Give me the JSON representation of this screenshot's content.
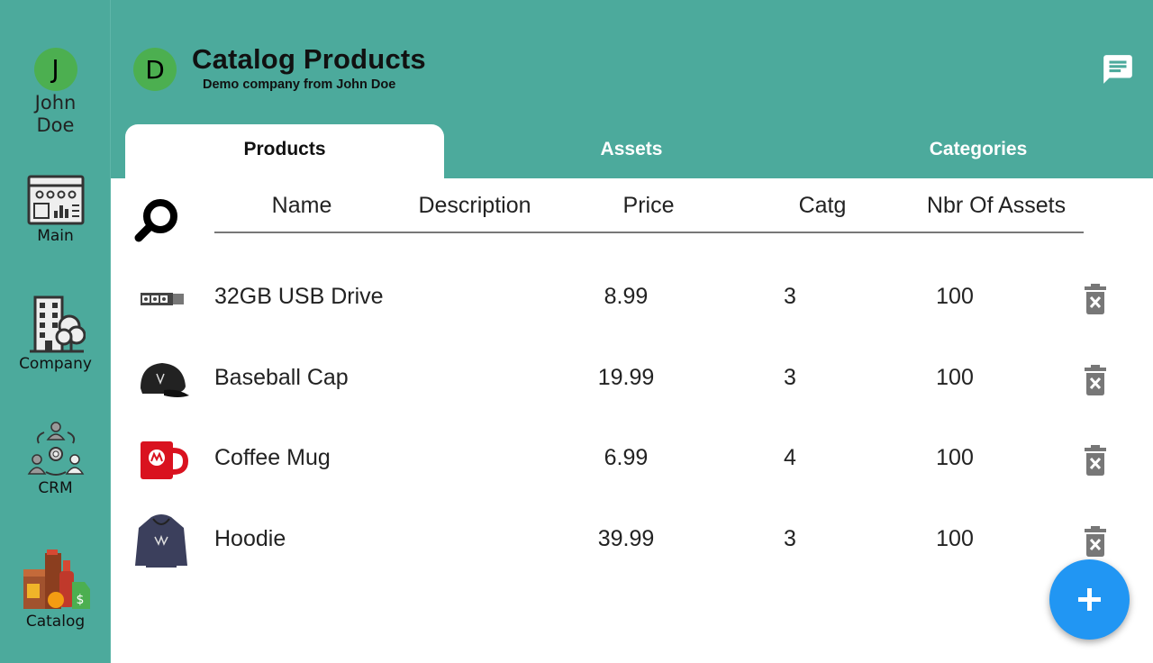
{
  "sidebar": {
    "user": {
      "initial": "J",
      "name": "John Doe"
    },
    "items": [
      {
        "label": "Main",
        "icon": "dashboard-icon"
      },
      {
        "label": "Company",
        "icon": "company-building-icon"
      },
      {
        "label": "CRM",
        "icon": "crm-people-icon"
      },
      {
        "label": "Catalog",
        "icon": "catalog-products-icon"
      }
    ]
  },
  "header": {
    "avatar_initial": "D",
    "title": "Catalog Products",
    "subtitle": "Demo company from John Doe",
    "chat_icon": "chat-icon"
  },
  "tabs": [
    {
      "label": "Products",
      "active": true
    },
    {
      "label": "Assets",
      "active": false
    },
    {
      "label": "Categories",
      "active": false
    }
  ],
  "table": {
    "columns": [
      "Name",
      "Description",
      "Price",
      "Catg",
      "Nbr Of Assets"
    ],
    "rows": [
      {
        "name": "32GB USB Drive",
        "price": "8.99",
        "catg": "3",
        "assets": "100",
        "thumb": "usb-drive-image"
      },
      {
        "name": "Baseball Cap",
        "price": "19.99",
        "catg": "3",
        "assets": "100",
        "thumb": "baseball-cap-image"
      },
      {
        "name": "Coffee Mug",
        "price": "6.99",
        "catg": "4",
        "assets": "100",
        "thumb": "coffee-mug-image"
      },
      {
        "name": "Hoodie",
        "price": "39.99",
        "catg": "3",
        "assets": "100",
        "thumb": "hoodie-image"
      }
    ]
  },
  "colors": {
    "primary": "#4caa9c",
    "avatar": "#4caf50",
    "fab": "#2196f3"
  }
}
